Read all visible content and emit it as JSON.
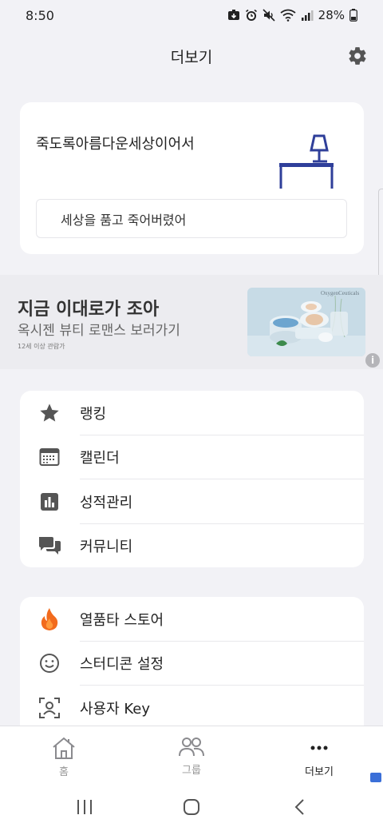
{
  "status_bar": {
    "time": "8:50",
    "battery": "28%"
  },
  "header": {
    "title": "더보기"
  },
  "profile": {
    "name": "죽도록아름다운세상이어서",
    "status_message": "세상을 품고 죽어버렸어"
  },
  "ad": {
    "title": "지금 이대로가 조아",
    "subtitle": "옥시젠 뷰티 로맨스 보러가기",
    "age_notice": "12세 이상 관람가",
    "brand_text": "OxygenCeuticals",
    "info_label": "i"
  },
  "menu_group_1": [
    {
      "label": "랭킹",
      "icon": "star-icon"
    },
    {
      "label": "캘린더",
      "icon": "calendar-icon"
    },
    {
      "label": "성적관리",
      "icon": "chart-icon"
    },
    {
      "label": "커뮤니티",
      "icon": "chat-bubbles-icon"
    }
  ],
  "menu_group_2": [
    {
      "label": "열품타 스토어",
      "icon": "fire-icon"
    },
    {
      "label": "스터디콘 설정",
      "icon": "smiley-icon"
    },
    {
      "label": "사용자 Key",
      "icon": "user-key-icon"
    }
  ],
  "bottom_nav": [
    {
      "label": "홈",
      "icon": "home-icon",
      "active": false
    },
    {
      "label": "그룹",
      "icon": "group-icon",
      "active": false
    },
    {
      "label": "더보기",
      "icon": "more-icon",
      "active": true
    }
  ],
  "colors": {
    "background": "#f2f2f6",
    "card": "#ffffff",
    "lamp": "#2f3f9a",
    "fire": "#f26b1d",
    "badge": "#3b6fd8"
  }
}
